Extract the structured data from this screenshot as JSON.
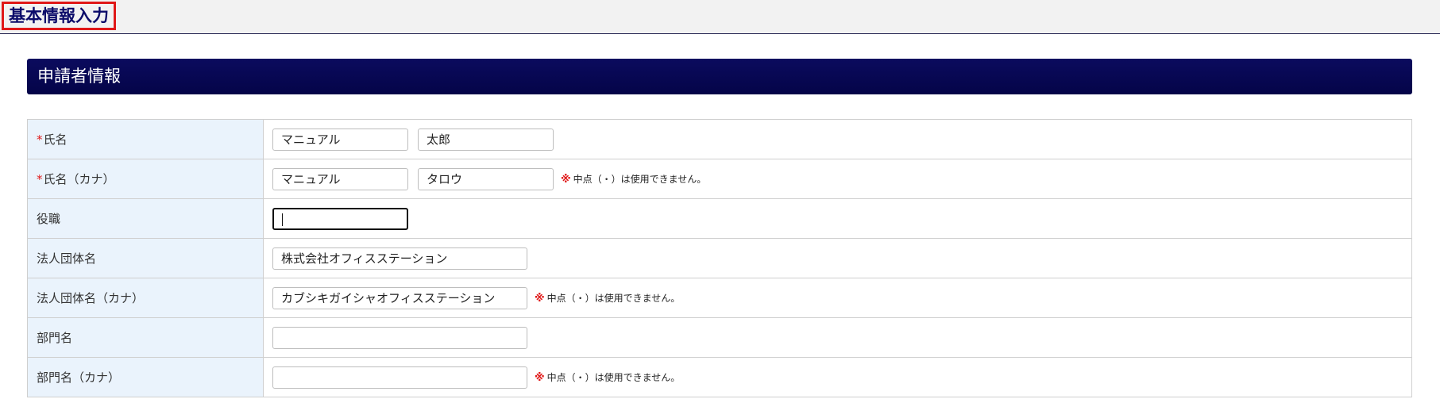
{
  "page": {
    "title": "基本情報入力"
  },
  "section": {
    "title": "申請者情報"
  },
  "required_mark": "*",
  "note_mark": "※",
  "note_text": "中点（・）は使用できません。",
  "rows": [
    {
      "label": "氏名",
      "required": true,
      "inputs": [
        "マニュアル",
        "太郎"
      ]
    },
    {
      "label": "氏名（カナ）",
      "required": true,
      "inputs": [
        "マニュアル",
        "タロウ"
      ],
      "note": true
    },
    {
      "label": "役職",
      "required": false,
      "inputs": [
        ""
      ],
      "focused": true
    },
    {
      "label": "法人団体名",
      "required": false,
      "inputs": [
        "株式会社オフィスステーション"
      ]
    },
    {
      "label": "法人団体名（カナ）",
      "required": false,
      "inputs": [
        "カブシキガイシャオフィスステーション"
      ],
      "note": true
    },
    {
      "label": "部門名",
      "required": false,
      "inputs": [
        ""
      ]
    },
    {
      "label": "部門名（カナ）",
      "required": false,
      "inputs": [
        ""
      ],
      "note": true
    }
  ]
}
